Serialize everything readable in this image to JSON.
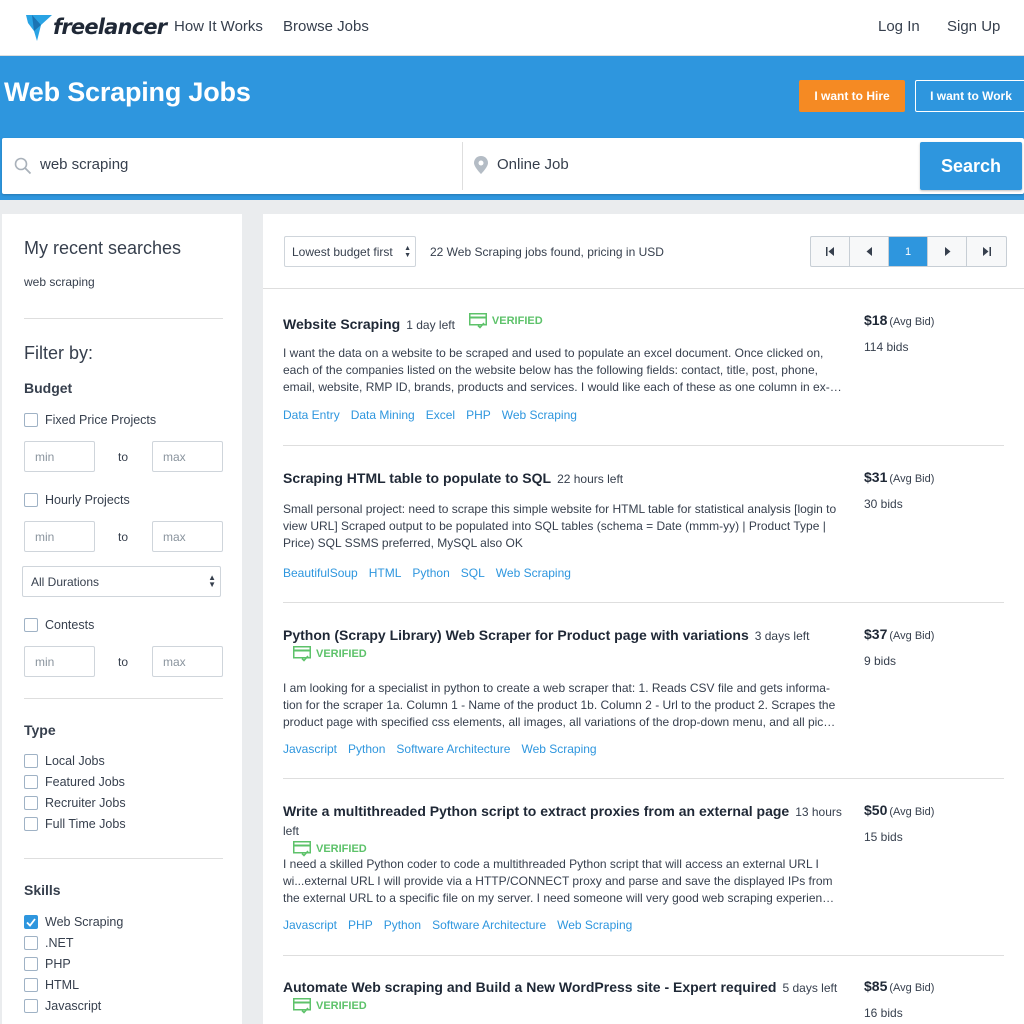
{
  "nav": {
    "logo_text": "freelancer",
    "links": [
      "How It Works",
      "Browse Jobs"
    ],
    "login": "Log In",
    "signup": "Sign Up"
  },
  "banner": {
    "title": "Web Scraping Jobs",
    "hire_button": "I want to Hire",
    "work_button": "I want to Work"
  },
  "search": {
    "query": "web scraping",
    "location": "Online Job",
    "button": "Search"
  },
  "sidebar": {
    "recent_title": "My recent searches",
    "recent_items": [
      "web scraping"
    ],
    "filter_title": "Filter by:",
    "budget_title": "Budget",
    "fixed_label": "Fixed Price Projects",
    "hourly_label": "Hourly Projects",
    "contests_label": "Contests",
    "min_placeholder": "min",
    "max_placeholder": "max",
    "to_label": "to",
    "duration_selected": "All Durations",
    "type_title": "Type",
    "type_items": [
      "Local Jobs",
      "Featured Jobs",
      "Recruiter Jobs",
      "Full Time Jobs"
    ],
    "skills_title": "Skills",
    "skills": [
      {
        "label": "Web Scraping",
        "checked": true
      },
      {
        "label": ".NET",
        "checked": false
      },
      {
        "label": "PHP",
        "checked": false
      },
      {
        "label": "HTML",
        "checked": false
      },
      {
        "label": "Javascript",
        "checked": false
      }
    ]
  },
  "results": {
    "sort_selected": "Lowest budget first",
    "count_text": "22 Web Scraping jobs found, pricing in USD",
    "current_page": "1",
    "verified_label": "VERIFIED",
    "avg_bid_label": "(Avg Bid)",
    "jobs": [
      {
        "title": "Website Scraping",
        "time": "1 day left",
        "verified": true,
        "description": "I want the data on a website to be scraped and used to populate an excel document. Once clicked on, each of the companies listed on the website below has the following fields: contact, title, post, phone, email, website, RMP ID, brands, products and services. I would like each of these as one column in ex-…",
        "tags": [
          "Data Entry",
          "Data Mining",
          "Excel",
          "PHP",
          "Web Scraping"
        ],
        "price": "$18",
        "bids": "114 bids"
      },
      {
        "title": "Scraping HTML table to populate to SQL",
        "time": "22 hours left",
        "verified": false,
        "description": "Small personal project: need to scrape this simple website for HTML table for statistical analysis [login to view URL] Scraped output to be populated into SQL tables (schema = Date (mmm-yy) | Product Type | Price) SQL SSMS preferred, MySQL also OK",
        "tags": [
          "BeautifulSoup",
          "HTML",
          "Python",
          "SQL",
          "Web Scraping"
        ],
        "price": "$31",
        "bids": "30 bids"
      },
      {
        "title": "Python (Scrapy Library) Web Scraper for Product page with variations",
        "time": "3 days left",
        "verified": true,
        "description": "I am looking for a specialist in python to create a web scraper that: 1. Reads CSV file and gets informa-tion for the scraper 1a. Column 1 - Name of the product 1b. Column 2 - Url to the product 2. Scrapes the product page with specified css elements, all images, all variations of the drop-down menu, and all pic…",
        "tags": [
          "Javascript",
          "Python",
          "Software Architecture",
          "Web Scraping"
        ],
        "price": "$37",
        "bids": "9 bids"
      },
      {
        "title": "Write a multithreaded Python script to extract proxies from an external page",
        "time": "13 hours left",
        "verified": true,
        "description": "I need a skilled Python coder to code a multithreaded Python script that will access an external URL I wi...external URL I will provide via a HTTP/CONNECT proxy and parse and save the displayed IPs from the external URL to a specific file on my server. I need someone will very good web scraping experien…",
        "tags": [
          "Javascript",
          "PHP",
          "Python",
          "Software Architecture",
          "Web Scraping"
        ],
        "price": "$50",
        "bids": "15 bids"
      },
      {
        "title": "Automate Web scraping and Build a New WordPress site - Expert required",
        "time": "5 days left",
        "verified": true,
        "description": "",
        "tags": [],
        "price": "$85",
        "bids": "16 bids"
      }
    ]
  }
}
